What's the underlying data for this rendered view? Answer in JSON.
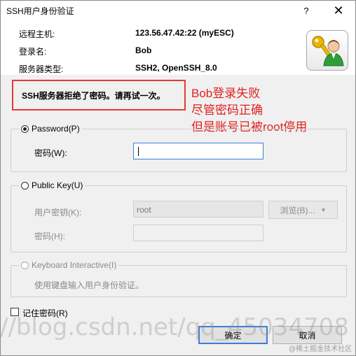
{
  "window": {
    "title": "SSH用户身份验证",
    "help_glyph": "?",
    "close_glyph": "✕"
  },
  "info": {
    "host_label": "远程主机:",
    "host_value": "123.56.47.42:22 (myESC)",
    "login_label": "登录名:",
    "login_value": "Bob",
    "server_label": "服务器类型:",
    "server_value": "SSH2, OpenSSH_8.0",
    "icon": "user-key-icon"
  },
  "error_message": "SSH服务器拒绝了密码。请再试一次。",
  "annotation": [
    "Bob登录失败",
    "尽管密码正确",
    "但是账号已被root停用"
  ],
  "password_method": {
    "label": "Password(P)",
    "field_label": "密码(W):",
    "value": ""
  },
  "public_key_method": {
    "label": "Public Key(U)",
    "user_key_label": "用户密钥(K):",
    "user_key_value": "root",
    "browse_label": "浏览(B)...",
    "password_label": "密码(H):"
  },
  "keyboard_interactive": {
    "label": "Keyboard Interactive(I)",
    "desc": "使用键盘输入用户身份验证。"
  },
  "remember_password": "记住密码(R)",
  "buttons": {
    "ok": "确定",
    "cancel": "取消"
  },
  "watermark": "//blog.csdn.net/qq_45034708",
  "watermark_small": "@稀土掘金技术社区"
}
